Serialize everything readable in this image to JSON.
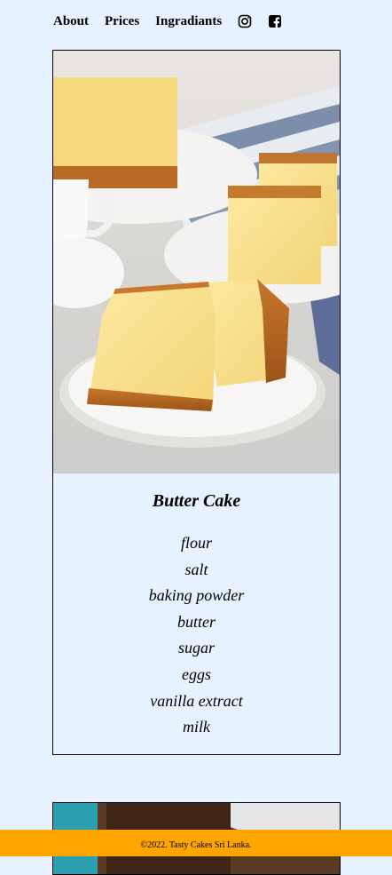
{
  "nav": {
    "links": [
      "About",
      "Prices",
      "Ingradiants"
    ],
    "icons": [
      "instagram-icon",
      "facebook-icon"
    ]
  },
  "card": {
    "image": "butter-cake-photo",
    "title": "Butter Cake",
    "ingredients": [
      "flour",
      "salt",
      "baking powder",
      "butter",
      "sugar",
      "eggs",
      "vanilla extract",
      "milk"
    ]
  },
  "footer": {
    "text": "©2022. Tasty Cakes Sri Lanka."
  },
  "colors": {
    "background": "#e6f2ff",
    "footer": "#ffa500"
  }
}
